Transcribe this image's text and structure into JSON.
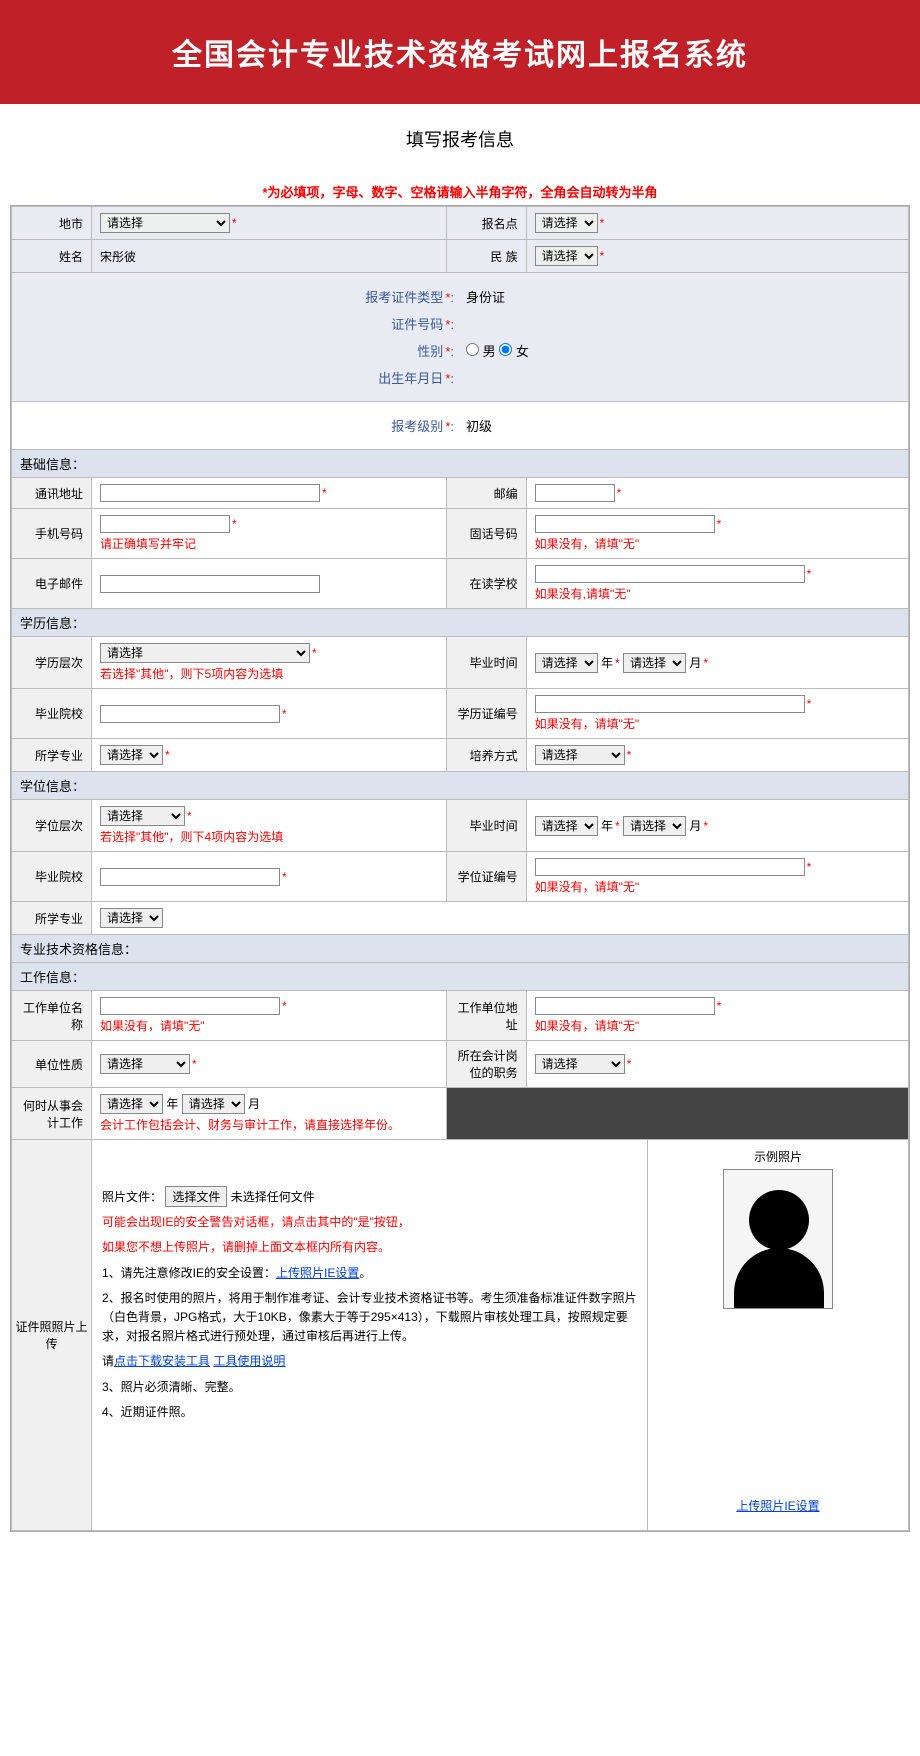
{
  "banner": "全国会计专业技术资格考试网上报名系统",
  "pageTitle": "填写报考信息",
  "notice": "*为必填项，字母、数字、空格请输入半角字符，全角会自动转为半角",
  "placeholder_select": "请选择",
  "labels": {
    "city": "地市",
    "site": "报名点",
    "name": "姓名",
    "ethnic": "民 族",
    "idType": "报考证件类型",
    "idNum": "证件号码",
    "gender": "性别",
    "male": "男",
    "female": "女",
    "birth": "出生年月日",
    "level": "报考级别",
    "basic": "基础信息：",
    "addr": "通讯地址",
    "zip": "邮编",
    "mobile": "手机号码",
    "phone": "固话号码",
    "email": "电子邮件",
    "school": "在读学校",
    "edu": "学历信息：",
    "eduLevel": "学历层次",
    "gradTime": "毕业时间",
    "gradSchool": "毕业院校",
    "eduCert": "学历证编号",
    "major": "所学专业",
    "trainMode": "培养方式",
    "degree": "学位信息：",
    "degreeLevel": "学位层次",
    "degreeCert": "学位证编号",
    "protitle": "专业技术资格信息：",
    "work": "工作信息：",
    "workName": "工作单位名称",
    "workAddr": "工作单位地址",
    "workType": "单位性质",
    "workPos": "所在会计岗位的职务",
    "workWhen": "何时从事会计工作",
    "year": "年",
    "month": "月",
    "photo": "证件照照片上传",
    "photoFile": "照片文件：",
    "chooseFile": "选择文件",
    "noFile": "未选择任何文件",
    "sample": "示例照片",
    "ieLink": "上传照片IE设置"
  },
  "values": {
    "idType": "身份证",
    "level": "初级",
    "name": "宋彤彼"
  },
  "hints": {
    "mobile": "请正确填写并牢记",
    "noneWu": "如果没有，请填\"无\"",
    "noneWu2": "如果没有,请填\"无\"",
    "eduOther": "若选择\"其他\"，则下5项内容为选填",
    "degreeOther": "若选择\"其他\"，则下4项内容为选填",
    "workWhen": "会计工作包括会计、财务与审计工作，请直接选择年份。",
    "photoWarn1": "可能会出现IE的安全警告对话框，请点击其中的\"是\"按钮，",
    "photoWarn2": "如果您不想上传照片，请删掉上面文本框内所有内容。",
    "photo1a": "1、请先注意修改IE的安全设置：",
    "photo1b": "。",
    "photo2": "2、报名时使用的照片，将用于制作准考证、会计专业技术资格证书等。考生须准备标准证件数字照片（白色背景，JPG格式，大于10KB，像素大于等于295×413），下载照片审核处理工具，按照规定要求，对报名照片格式进行预处理，通过审核后再进行上传。",
    "photoLinkA": "点击下载安装工具",
    "photoLinkB": "工具使用说明",
    "photoPlease": "请",
    "photo3": "3、照片必须清晰、完整。",
    "photo4": "4、近期证件照。"
  }
}
